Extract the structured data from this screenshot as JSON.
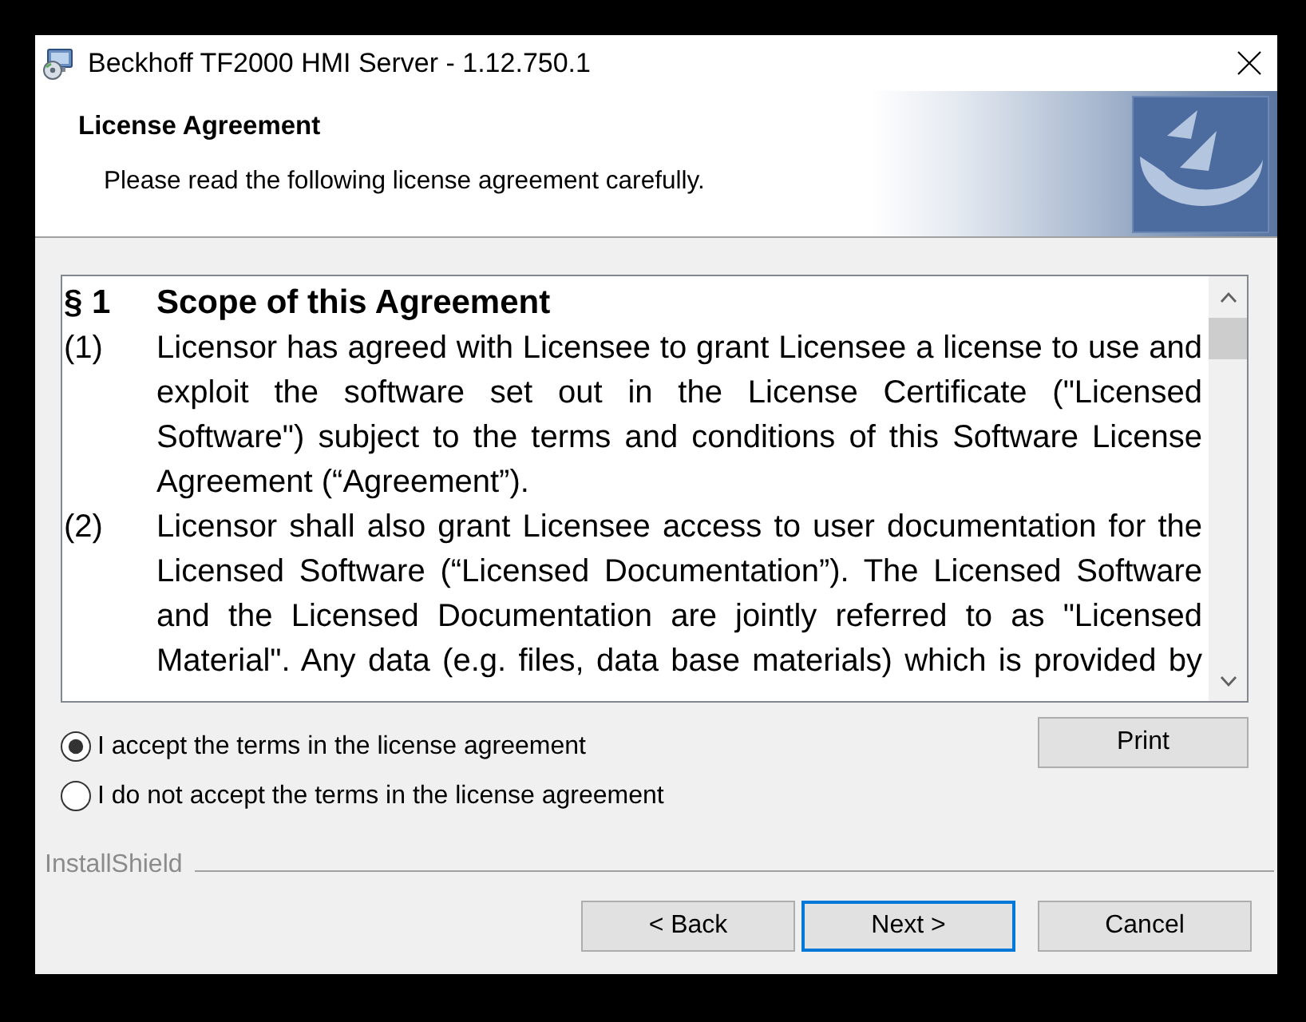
{
  "window": {
    "title": "Beckhoff TF2000 HMI Server - 1.12.750.1"
  },
  "header": {
    "title": "License Agreement",
    "subtitle": "Please read the following license agreement carefully."
  },
  "license": {
    "heading": {
      "number": "§ 1",
      "title": "Scope of this Agreement"
    },
    "paragraphs": [
      {
        "number": "(1)",
        "text": "Licensor has agreed with Licensee to grant Licensee a license to use and exploit the software set out in the License Certificate (\"Licensed Software\") subject to the terms and conditions of this Software License Agreement (“Agreement”).",
        "continues": false
      },
      {
        "number": "(2)",
        "text": "Licensor shall also grant Licensee access to user documentation for the Licensed Software (“Licensed Documentation”). The Licensed Software and the Licensed Documentation are jointly referred to as \"Licensed Material\". Any data (e.g. files, data base materials) which is provided by",
        "continues": true
      }
    ]
  },
  "options": [
    {
      "label": "I accept the terms in the license agreement",
      "selected": true
    },
    {
      "label": "I do not accept the terms in the license agreement",
      "selected": false
    }
  ],
  "print_button": {
    "label": "Print"
  },
  "brand": "InstallShield",
  "buttons": [
    {
      "kind": "back",
      "label": "< Back",
      "default": false
    },
    {
      "kind": "next",
      "label": "Next >",
      "default": true
    },
    {
      "kind": "cancel",
      "label": "Cancel",
      "default": false
    }
  ]
}
